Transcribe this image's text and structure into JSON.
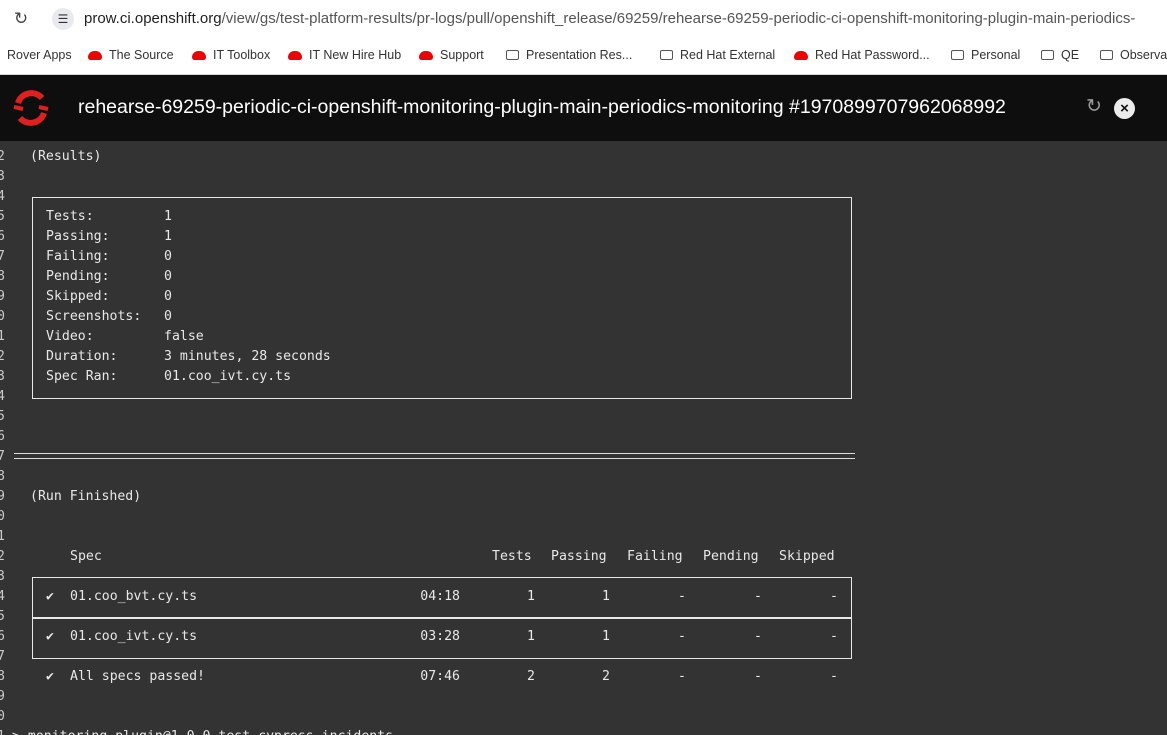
{
  "browser": {
    "url_host": "prow.ci.openshift.org",
    "url_path": "/view/gs/test-platform-results/pr-logs/pull/openshift_release/69259/rehearse-69259-periodic-ci-openshift-monitoring-plugin-main-periodics-"
  },
  "bookmarks": [
    {
      "label": "Rover Apps",
      "icon": "none"
    },
    {
      "label": "The Source",
      "icon": "redhat-icon"
    },
    {
      "label": "IT Toolbox",
      "icon": "redhat-icon"
    },
    {
      "label": "IT New Hire Hub",
      "icon": "redhat-icon"
    },
    {
      "label": "Support",
      "icon": "redhat-icon"
    },
    {
      "label": "Presentation Res...",
      "icon": "folder-icon"
    },
    {
      "label": "Red Hat External",
      "icon": "folder-icon"
    },
    {
      "label": "Red Hat Password...",
      "icon": "redhat-icon"
    },
    {
      "label": "Personal",
      "icon": "folder-icon"
    },
    {
      "label": "QE",
      "icon": "folder-icon"
    },
    {
      "label": "Observa",
      "icon": "folder-icon"
    }
  ],
  "header": {
    "title": "rehearse-69259-periodic-ci-openshift-monitoring-plugin-main-periodics-monitoring #1970899707962068992"
  },
  "line_numbers": [
    "2",
    "3",
    "4",
    "5",
    "6",
    "7",
    "8",
    "9",
    "0",
    "1",
    "2",
    "3",
    "4",
    "5",
    "6",
    "7",
    "8",
    "9",
    "0",
    "1",
    "2",
    "3",
    "4",
    "5",
    "6",
    "7",
    "8",
    "9",
    "0",
    "1"
  ],
  "results": {
    "heading": "(Results)",
    "rows": [
      {
        "label": "Tests:",
        "value": "1"
      },
      {
        "label": "Passing:",
        "value": "1"
      },
      {
        "label": "Failing:",
        "value": "0"
      },
      {
        "label": "Pending:",
        "value": "0"
      },
      {
        "label": "Skipped:",
        "value": "0"
      },
      {
        "label": "Screenshots:",
        "value": "0"
      },
      {
        "label": "Video:",
        "value": "false"
      },
      {
        "label": "Duration:",
        "value": "3 minutes, 28 seconds"
      },
      {
        "label": "Spec Ran:",
        "value": "01.coo_ivt.cy.ts"
      }
    ]
  },
  "run_finished": {
    "heading": "(Run Finished)",
    "columns": {
      "spec": "Spec",
      "tests": "Tests",
      "passing": "Passing",
      "failing": "Failing",
      "pending": "Pending",
      "skipped": "Skipped"
    },
    "specs": [
      {
        "check": "✔",
        "name": "01.coo_bvt.cy.ts",
        "time": "04:18",
        "tests": "1",
        "passing": "1",
        "failing": "-",
        "pending": "-",
        "skipped": "-"
      },
      {
        "check": "✔",
        "name": "01.coo_ivt.cy.ts",
        "time": "03:28",
        "tests": "1",
        "passing": "1",
        "failing": "-",
        "pending": "-",
        "skipped": "-"
      }
    ],
    "summary": {
      "check": "✔",
      "name": "All specs passed!",
      "time": "07:46",
      "tests": "2",
      "passing": "2",
      "failing": "-",
      "pending": "-",
      "skipped": "-"
    }
  },
  "next_line": "> monitoring-plugin@1.0.0 test-cypress-incidents"
}
